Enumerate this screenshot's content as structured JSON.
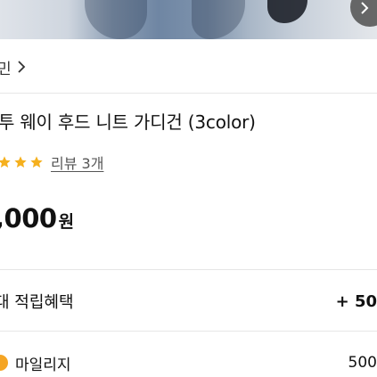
{
  "brand": {
    "name": "민"
  },
  "product": {
    "title": "투 웨이 후드 니트 가디건 (3color)"
  },
  "rating": {
    "stars": 3,
    "review_link": "리뷰 3개",
    "star_color": "#F5B01E"
  },
  "price": {
    "amount": ",000",
    "unit": "원"
  },
  "benefits": {
    "max_points_label": "대 적립혜택",
    "max_points_value": "+ 50",
    "mileage_label": "마일리지",
    "mileage_value": "500"
  },
  "colors": {
    "coin": "#F5A524",
    "divider": "#E6E6E6"
  }
}
